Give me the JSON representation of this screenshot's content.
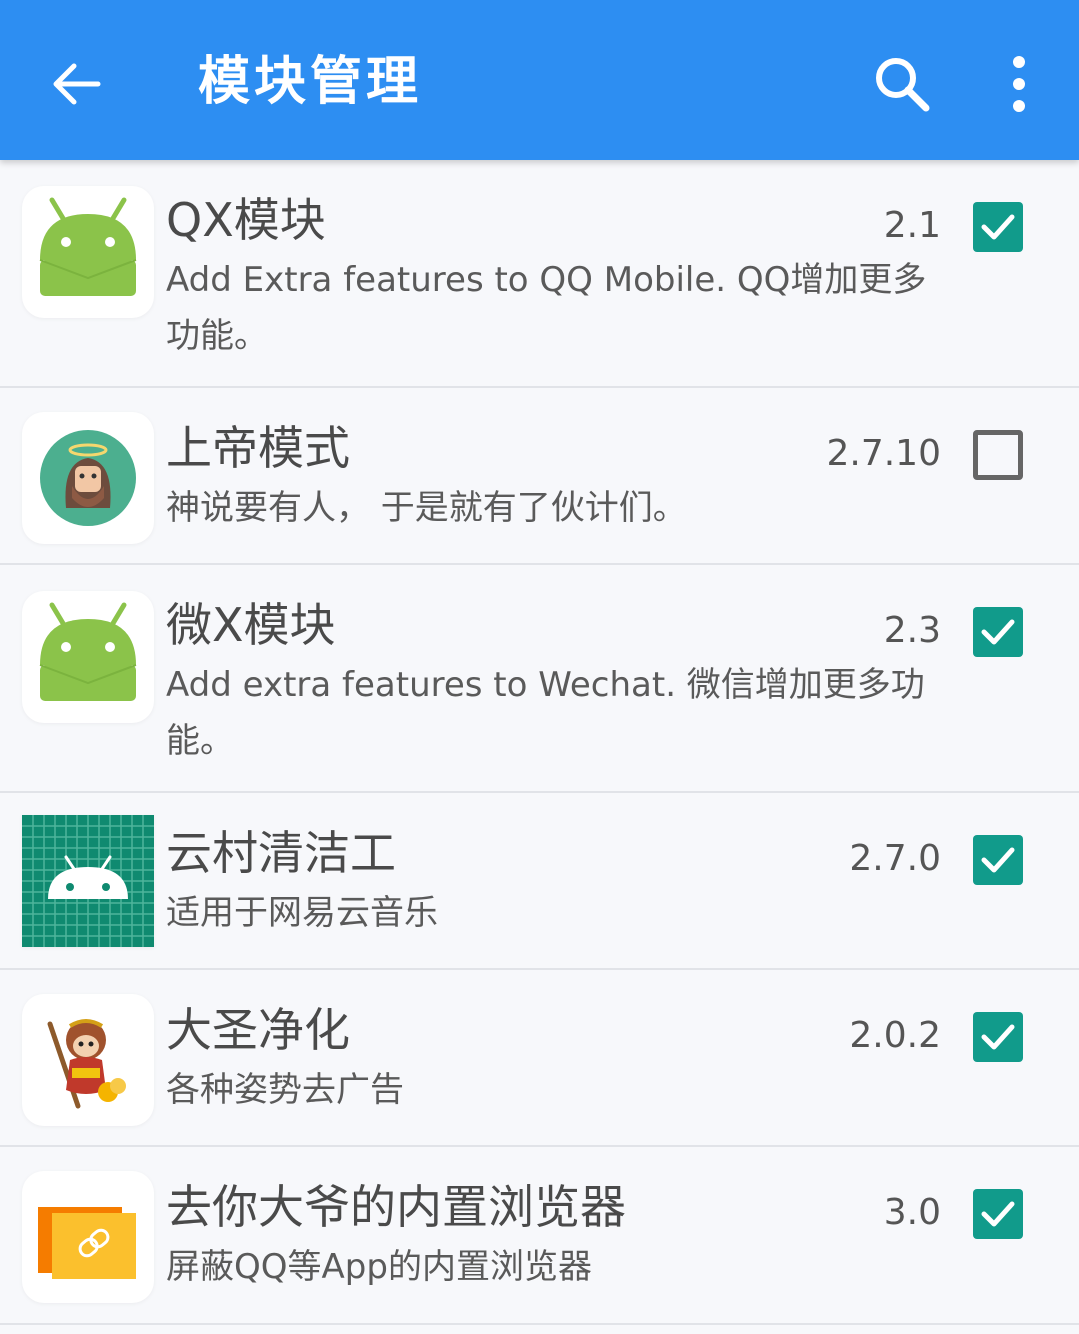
{
  "appbar": {
    "title": "模块管理",
    "back_icon": "arrow-left-icon",
    "search_icon": "search-icon",
    "more_icon": "more-vert-icon",
    "background": "#2d8ef2"
  },
  "modules": [
    {
      "name": "QX模块",
      "version": "2.1",
      "description": "Add Extra features to QQ Mobile. QQ增加更多功能。",
      "enabled": true,
      "icon": "android-robot-icon"
    },
    {
      "name": "上帝模式",
      "version": "2.7.10",
      "description": "神说要有人， 于是就有了伙计们。",
      "enabled": false,
      "icon": "jesus-avatar-icon"
    },
    {
      "name": "微X模块",
      "version": "2.3",
      "description": "Add extra features to Wechat. 微信增加更多功能。",
      "enabled": true,
      "icon": "android-robot-icon"
    },
    {
      "name": "云村清洁工",
      "version": "2.7.0",
      "description": "适用于网易云音乐",
      "enabled": true,
      "icon": "android-grid-icon"
    },
    {
      "name": "大圣净化",
      "version": "2.0.2",
      "description": "各种姿势去广告",
      "enabled": true,
      "icon": "monkey-king-icon"
    },
    {
      "name": "去你大爷的内置浏览器",
      "version": "3.0",
      "description": "屏蔽QQ等App的内置浏览器",
      "enabled": true,
      "icon": "link-card-icon"
    }
  ],
  "colors": {
    "accent_checkbox": "#119b8b",
    "android_green": "#8bc34a"
  }
}
